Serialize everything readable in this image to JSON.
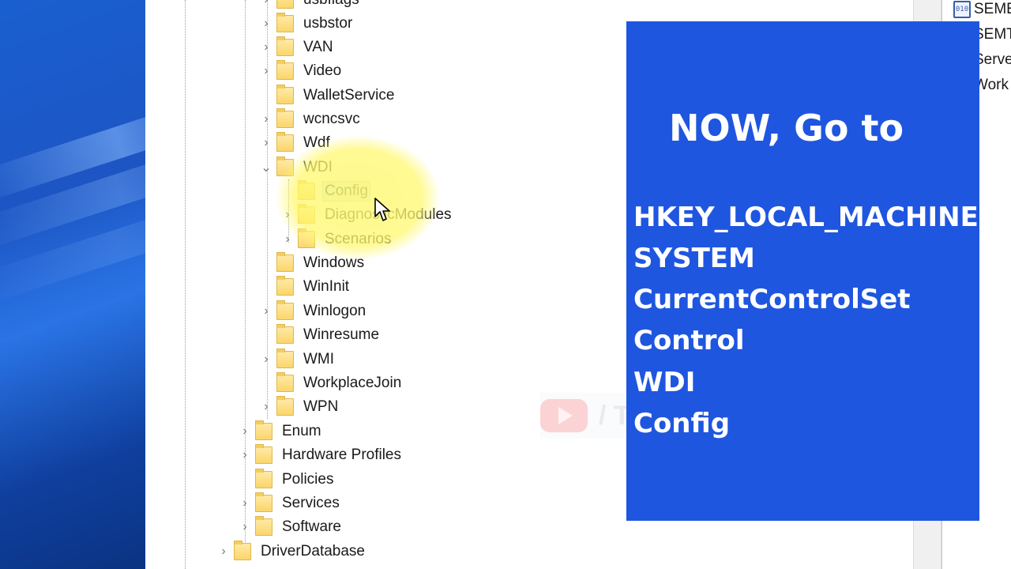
{
  "overlay": {
    "heading": "NOW, Go to",
    "path": [
      "HKEY_LOCAL_MACHINE",
      "SYSTEM",
      "CurrentControlSet",
      "Control",
      "WDI",
      "Config"
    ]
  },
  "tree": {
    "nodes": [
      {
        "label": "usbflags",
        "expander": "›"
      },
      {
        "label": "usbstor",
        "expander": "›"
      },
      {
        "label": "VAN",
        "expander": "›"
      },
      {
        "label": "Video",
        "expander": "›"
      },
      {
        "label": "WalletService",
        "expander": ""
      },
      {
        "label": "wcncsvc",
        "expander": "›"
      },
      {
        "label": "Wdf",
        "expander": "›"
      },
      {
        "label": "WDI",
        "expander": "⌄"
      },
      {
        "label": "Config",
        "expander": ""
      },
      {
        "label": "DiagnosticModules",
        "expander": "›"
      },
      {
        "label": "Scenarios",
        "expander": "›"
      },
      {
        "label": "Windows",
        "expander": ""
      },
      {
        "label": "WinInit",
        "expander": ""
      },
      {
        "label": "Winlogon",
        "expander": "›"
      },
      {
        "label": "Winresume",
        "expander": ""
      },
      {
        "label": "WMI",
        "expander": "›"
      },
      {
        "label": "WorkplaceJoin",
        "expander": ""
      },
      {
        "label": "WPN",
        "expander": "›"
      },
      {
        "label": "Enum",
        "expander": "›"
      },
      {
        "label": "Hardware Profiles",
        "expander": "›"
      },
      {
        "label": "Policies",
        "expander": ""
      },
      {
        "label": "Services",
        "expander": "›"
      },
      {
        "label": "Software",
        "expander": "›"
      },
      {
        "label": "DriverDatabase",
        "expander": "›"
      }
    ]
  },
  "values_pane": {
    "rows": [
      {
        "icon": "010",
        "label": "SEME"
      },
      {
        "icon": "",
        "label": "SEMT"
      },
      {
        "icon": "",
        "label": "Serve"
      },
      {
        "icon": "",
        "label": "Work"
      }
    ]
  },
  "watermark": {
    "text": "/ The Geek Page"
  }
}
